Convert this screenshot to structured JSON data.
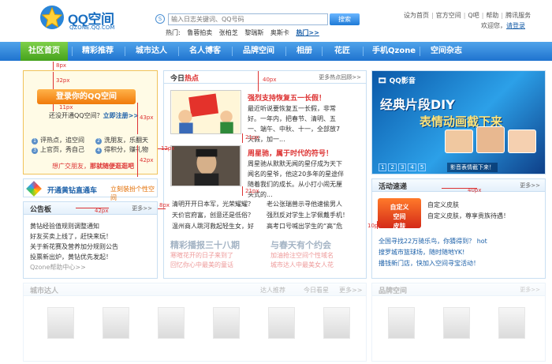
{
  "header": {
    "brand": "QQ空间",
    "brand_sub": "QZONE.QQ.COM",
    "search_placeholder": "输入日志关键词、QQ号码",
    "search_button": "搜索",
    "hot_label": "热门:",
    "hot_items": [
      "鲁蓉拍卖",
      "张柏芝",
      "黎瑞斯",
      "奥斯卡"
    ],
    "hot_more": "热门>>",
    "top_links": [
      "设为首页",
      "官方空间",
      "Q吧",
      "帮助",
      "腾讯服务"
    ],
    "welcome": "欢迎您，",
    "login_link": "请登录"
  },
  "nav": {
    "items": [
      "社区首页",
      "精彩推荐",
      "城市达人",
      "名人博客",
      "品牌空间",
      "相册",
      "花匠",
      "手机Qzone",
      "空间杂志"
    ]
  },
  "login": {
    "button": "登录你的QQ空间",
    "hint": "还没开通QQ空间？",
    "hint_link": "立即注册>>",
    "features": [
      "评热点，追空间",
      "洗朋友，乐翻天",
      "上官页，秀自己",
      "得积分，赚礼物"
    ],
    "feature_nums": [
      "1",
      "2",
      "3",
      "4"
    ],
    "invite": "想广交朋友，",
    "invite_link": "那就随便逛逛吧"
  },
  "vip": {
    "title": "开通黄钻直通车",
    "link": "立刻装扮个性空间"
  },
  "notice": {
    "title": "公告板",
    "more": "更多>>",
    "items": [
      "黄钻经验值规则调整通知",
      "好友买卖上线了，赶快来玩！",
      "关于新花赛及营养加分规则公告",
      "投票新出炉，黄钻优先发起！",
      "Qzone帮助中心>>"
    ]
  },
  "hotnews": {
    "title_a": "今日",
    "title_b": "热点",
    "more": "更多热点回顾>>",
    "story1_title": "强烈支持恢复五一长假！",
    "story1_body": "最近听说要恢复五一长假，非常好。一年内，把春节、清明、五一、端午、中秋、十一，全部放7天假，加一...",
    "story2_title": "周星驰，属于时代的符号！",
    "story2_body": "周星驰从默默无闻的星仔成为天下闻名的星爷，他这20多年的星途伴随着我们的成长。从小打小闹无厘头式的...",
    "list": [
      [
        "清明开开日本军，光荣耀耀？",
        "老公张瑞兽示寻他速偷男人"
      ],
      [
        "天价官府富，创意还是低俗？",
        "强烈反对学生上学佩戴手机！"
      ],
      [
        "温州商人跳河救起轻生女，好",
        "高考口号喊出学生的“高”危"
      ]
    ],
    "banner1": "精彩播报三十八期",
    "banner1_sub": [
      "寒暄花开的日子来到了",
      "回忆你心中最美的童话"
    ],
    "banner2": "与春天有个约会",
    "banner2_sub": [
      "加油抢注空间个性域名",
      "城市达人中最美女人花"
    ]
  },
  "movie": {
    "logo": "QQ影音",
    "headline1": "经典片段DIY",
    "headline2": "表情动画截下来",
    "pages": [
      "1",
      "2",
      "3",
      "4",
      "5"
    ],
    "caption": "影音表情截下来！"
  },
  "activity": {
    "title": "活动速递",
    "more": "更多>>",
    "promo": "自定义\n空间\n皮肤",
    "promo_texts": [
      "自定义皮肤",
      "自定义皮肤，尊享贵族待遇！"
    ],
    "items": [
      "全国寻找22万骑乐鸟，你猜得到？ hot",
      "搜罗城市篮球场，随时随地YK!",
      "播钱新门店，快加入空间寻宝活动！"
    ]
  },
  "bottom": {
    "city_title": "城市达人",
    "tabs": [
      "达人推荐",
      "今日看星",
      "更多>>"
    ],
    "brand_title": "品牌空间",
    "brand_more": "更多>>"
  },
  "annotations": [
    "8px",
    "32px",
    "11px",
    "43px",
    "42px",
    "40px",
    "21px",
    "12px",
    "21px",
    "42px",
    "8px",
    "40px",
    "10px"
  ],
  "colors": {
    "nav_blue": "#1f73cf",
    "nav_active": "#45a21c",
    "accent_red": "#dd3333",
    "accent_orange": "#e36d00",
    "link_blue": "#1a5fa8"
  }
}
